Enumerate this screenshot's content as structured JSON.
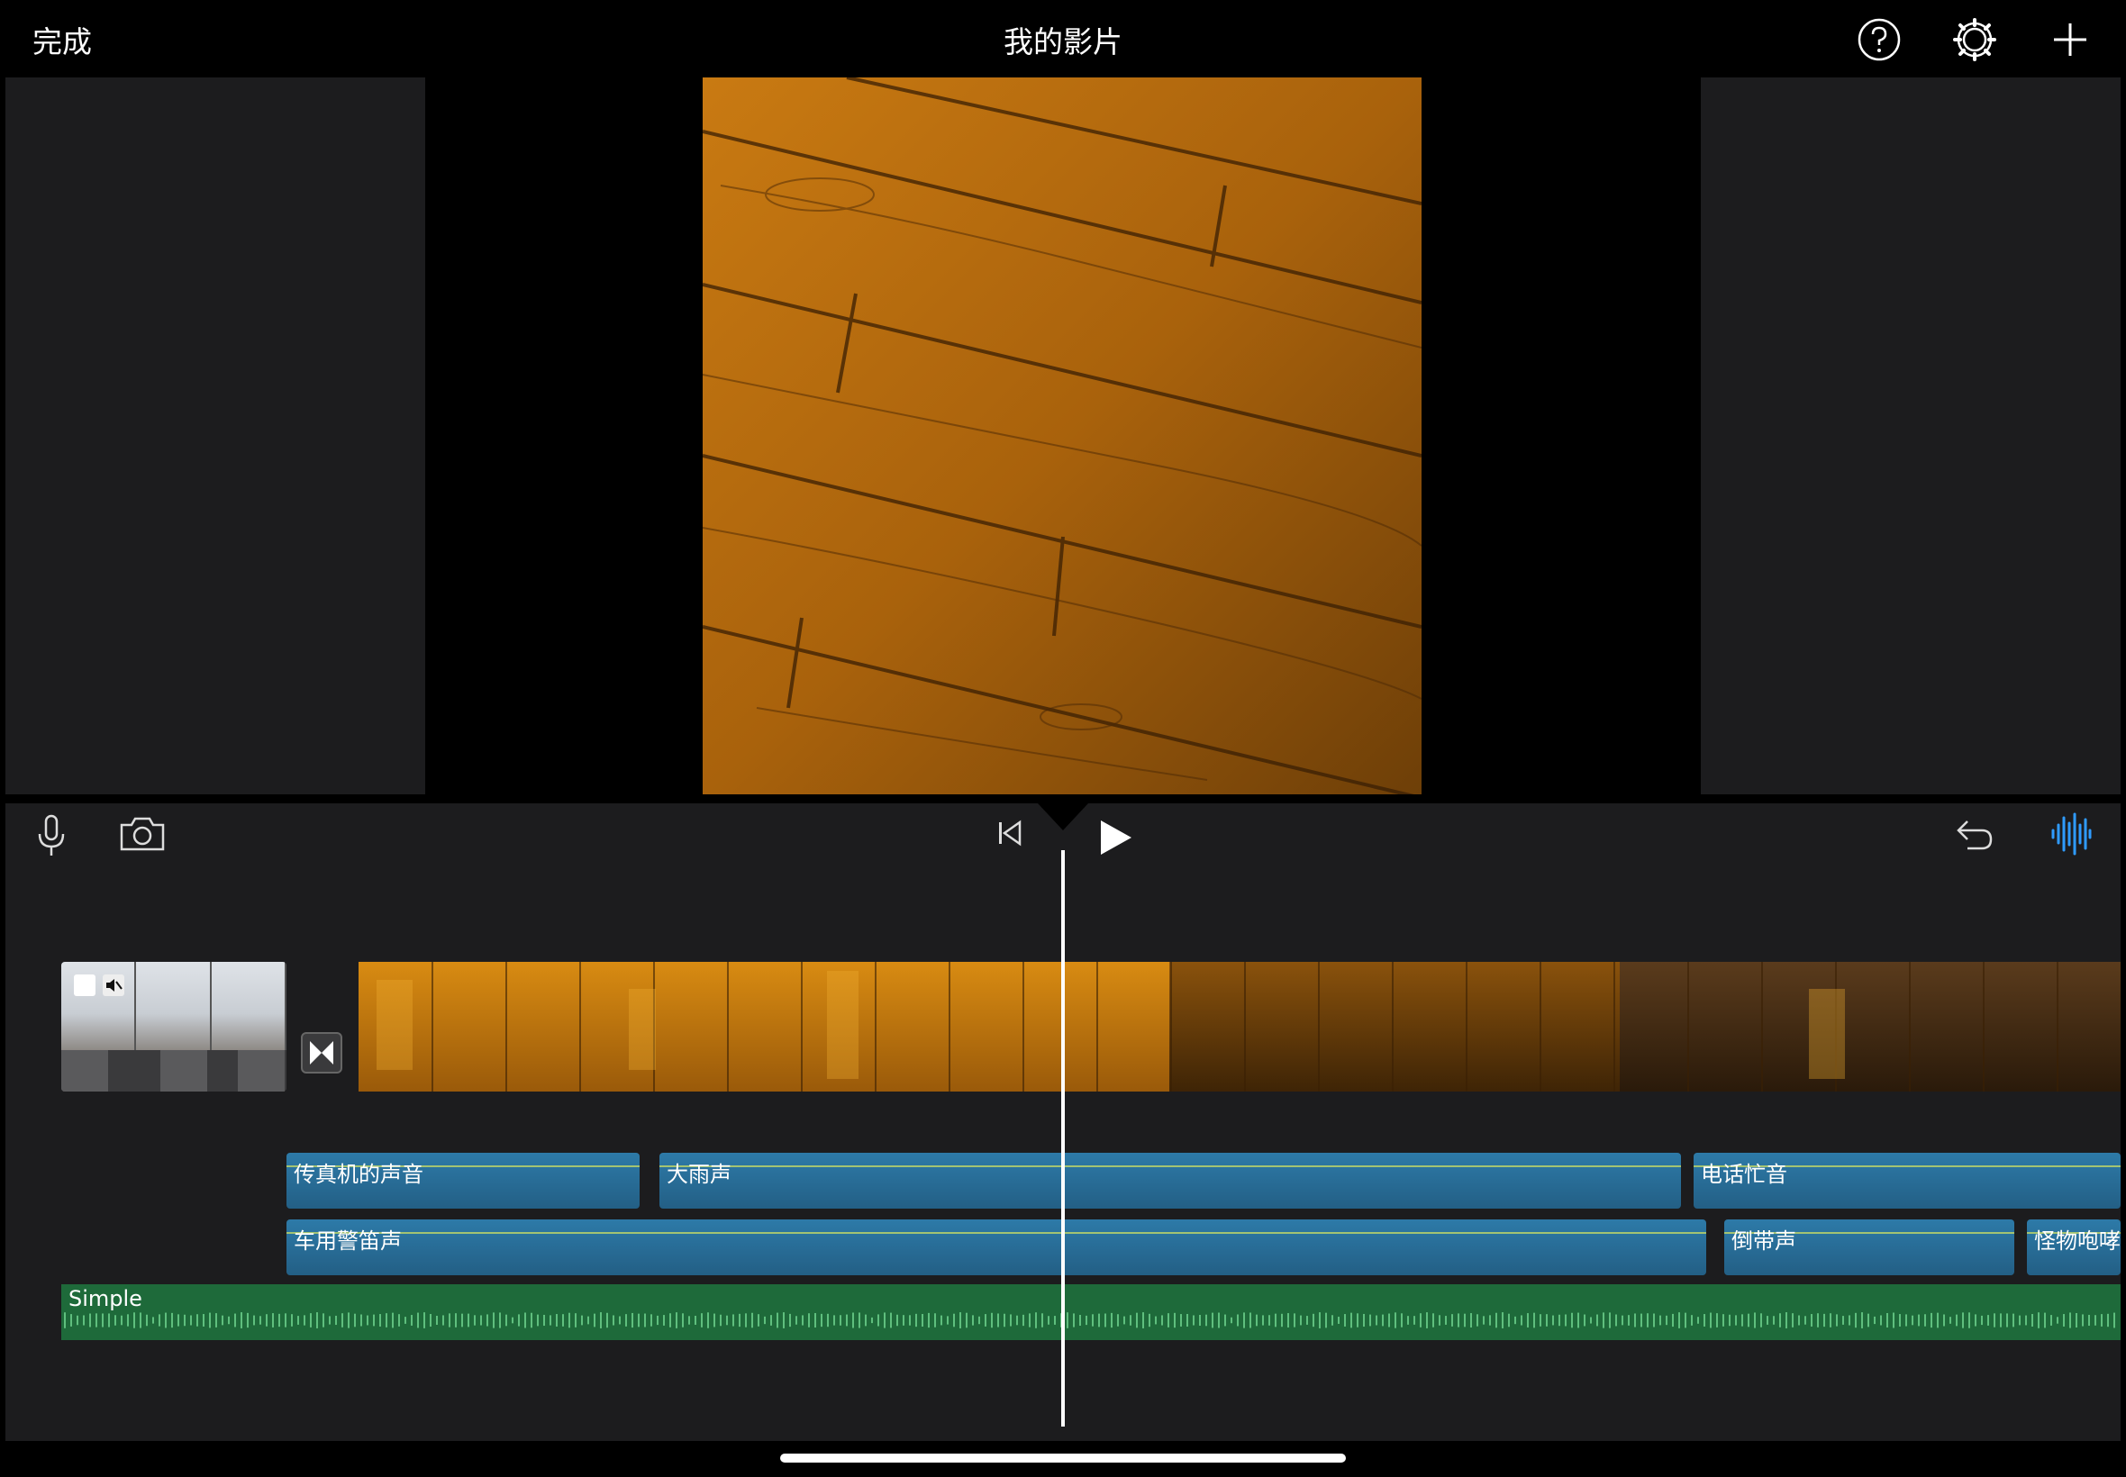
{
  "header": {
    "done_label": "完成",
    "title": "我的影片",
    "icons": [
      "help-icon",
      "settings-icon",
      "add-icon"
    ]
  },
  "toolbar": {
    "left_icons": [
      "microphone-icon",
      "camera-icon"
    ],
    "center_icons": [
      "skip-to-start-icon",
      "play-icon"
    ],
    "right_icons": [
      "undo-icon",
      "audio-waveform-icon"
    ],
    "accent_color": "#2f9bff"
  },
  "timeline": {
    "audio_clips": [
      {
        "label": "传真机的声音"
      },
      {
        "label": "大雨声"
      },
      {
        "label": "电话忙音"
      },
      {
        "label": "车用警笛声"
      },
      {
        "label": "倒带声"
      },
      {
        "label": "怪物咆哮"
      }
    ],
    "music_clip": {
      "label": "Simple"
    }
  }
}
